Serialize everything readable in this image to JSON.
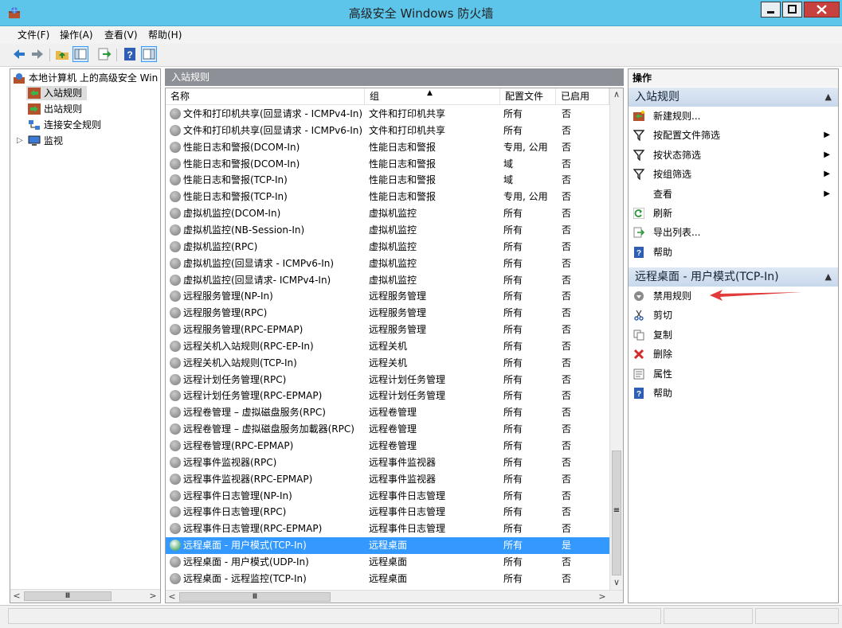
{
  "window": {
    "title": "高级安全 Windows 防火墙",
    "colors": {
      "titlebar": "#5cc5e9",
      "selection": "#3399ff",
      "section_header": "#c8d8ec",
      "annotation_arrow": "#e23b3b"
    }
  },
  "menu": [
    "文件(F)",
    "操作(A)",
    "查看(V)",
    "帮助(H)"
  ],
  "toolbar_icons": [
    "back-arrow-icon",
    "forward-arrow-icon",
    "folder-up-icon",
    "show-hide-tree-icon",
    "export-list-icon",
    "help-icon",
    "show-hide-action-pane-icon"
  ],
  "tree": {
    "root": "本地计算机 上的高级安全 Win",
    "items": [
      {
        "label": "入站规则",
        "selected": true,
        "icon": "inbound-rules-icon"
      },
      {
        "label": "出站规则",
        "icon": "outbound-rules-icon"
      },
      {
        "label": "连接安全规则",
        "icon": "connection-security-icon"
      },
      {
        "label": "监视",
        "icon": "monitor-icon",
        "expander": "▷"
      }
    ],
    "scroll_glyph": "Ⅲ"
  },
  "center": {
    "header": "入站规则",
    "columns": [
      "名称",
      "组",
      "配置文件",
      "已启用"
    ],
    "sort_glyph": "▲",
    "rows": [
      {
        "name": "文件和打印机共享(回显请求 - ICMPv4-In)",
        "group": "文件和打印机共享",
        "profile": "所有",
        "enabled": "否"
      },
      {
        "name": "文件和打印机共享(回显请求 - ICMPv6-In)",
        "group": "文件和打印机共享",
        "profile": "所有",
        "enabled": "否"
      },
      {
        "name": "性能日志和警报(DCOM-In)",
        "group": "性能日志和警报",
        "profile": "专用, 公用",
        "enabled": "否"
      },
      {
        "name": "性能日志和警报(DCOM-In)",
        "group": "性能日志和警报",
        "profile": "域",
        "enabled": "否"
      },
      {
        "name": "性能日志和警报(TCP-In)",
        "group": "性能日志和警报",
        "profile": "域",
        "enabled": "否"
      },
      {
        "name": "性能日志和警报(TCP-In)",
        "group": "性能日志和警报",
        "profile": "专用, 公用",
        "enabled": "否"
      },
      {
        "name": "虚拟机监控(DCOM-In)",
        "group": "虚拟机监控",
        "profile": "所有",
        "enabled": "否"
      },
      {
        "name": "虚拟机监控(NB-Session-In)",
        "group": "虚拟机监控",
        "profile": "所有",
        "enabled": "否"
      },
      {
        "name": "虚拟机监控(RPC)",
        "group": "虚拟机监控",
        "profile": "所有",
        "enabled": "否"
      },
      {
        "name": "虚拟机监控(回显请求 - ICMPv6-In)",
        "group": "虚拟机监控",
        "profile": "所有",
        "enabled": "否"
      },
      {
        "name": "虚拟机监控(回显请求- ICMPv4-In)",
        "group": "虚拟机监控",
        "profile": "所有",
        "enabled": "否"
      },
      {
        "name": "远程服务管理(NP-In)",
        "group": "远程服务管理",
        "profile": "所有",
        "enabled": "否"
      },
      {
        "name": "远程服务管理(RPC)",
        "group": "远程服务管理",
        "profile": "所有",
        "enabled": "否"
      },
      {
        "name": "远程服务管理(RPC-EPMAP)",
        "group": "远程服务管理",
        "profile": "所有",
        "enabled": "否"
      },
      {
        "name": "远程关机入站规则(RPC-EP-In)",
        "group": "远程关机",
        "profile": "所有",
        "enabled": "否"
      },
      {
        "name": "远程关机入站规则(TCP-In)",
        "group": "远程关机",
        "profile": "所有",
        "enabled": "否"
      },
      {
        "name": "远程计划任务管理(RPC)",
        "group": "远程计划任务管理",
        "profile": "所有",
        "enabled": "否"
      },
      {
        "name": "远程计划任务管理(RPC-EPMAP)",
        "group": "远程计划任务管理",
        "profile": "所有",
        "enabled": "否"
      },
      {
        "name": "远程卷管理 – 虚拟磁盘服务(RPC)",
        "group": "远程卷管理",
        "profile": "所有",
        "enabled": "否"
      },
      {
        "name": "远程卷管理 – 虚拟磁盘服务加載器(RPC)",
        "group": "远程卷管理",
        "profile": "所有",
        "enabled": "否"
      },
      {
        "name": "远程卷管理(RPC-EPMAP)",
        "group": "远程卷管理",
        "profile": "所有",
        "enabled": "否"
      },
      {
        "name": "远程事件监视器(RPC)",
        "group": "远程事件监视器",
        "profile": "所有",
        "enabled": "否"
      },
      {
        "name": "远程事件监视器(RPC-EPMAP)",
        "group": "远程事件监视器",
        "profile": "所有",
        "enabled": "否"
      },
      {
        "name": "远程事件日志管理(NP-In)",
        "group": "远程事件日志管理",
        "profile": "所有",
        "enabled": "否"
      },
      {
        "name": "远程事件日志管理(RPC)",
        "group": "远程事件日志管理",
        "profile": "所有",
        "enabled": "否"
      },
      {
        "name": "远程事件日志管理(RPC-EPMAP)",
        "group": "远程事件日志管理",
        "profile": "所有",
        "enabled": "否"
      },
      {
        "name": "远程桌面 - 用户模式(TCP-In)",
        "group": "远程桌面",
        "profile": "所有",
        "enabled": "是",
        "selected": true
      },
      {
        "name": "远程桌面 - 用户模式(UDP-In)",
        "group": "远程桌面",
        "profile": "所有",
        "enabled": "否"
      },
      {
        "name": "远程桌面 - 远程监控(TCP-In)",
        "group": "远程桌面",
        "profile": "所有",
        "enabled": "否"
      }
    ],
    "scroll_glyph": "Ⅲ",
    "vscroll_grip": "≡"
  },
  "actions": {
    "title": "操作",
    "section1": {
      "header": "入站规则",
      "items": [
        {
          "label": "新建规则...",
          "icon": "new-rule-icon"
        },
        {
          "label": "按配置文件筛选",
          "icon": "filter-icon",
          "submenu": true
        },
        {
          "label": "按状态筛选",
          "icon": "filter-icon",
          "submenu": true
        },
        {
          "label": "按组筛选",
          "icon": "filter-icon",
          "submenu": true
        },
        {
          "label": "查看",
          "icon": "",
          "submenu": true
        },
        {
          "label": "刷新",
          "icon": "refresh-icon"
        },
        {
          "label": "导出列表...",
          "icon": "export-list-icon"
        },
        {
          "label": "帮助",
          "icon": "help-icon"
        }
      ]
    },
    "section2": {
      "header": "远程桌面 - 用户模式(TCP-In)",
      "items": [
        {
          "label": "禁用规则",
          "icon": "disable-rule-icon"
        },
        {
          "label": "剪切",
          "icon": "cut-icon"
        },
        {
          "label": "复制",
          "icon": "copy-icon"
        },
        {
          "label": "删除",
          "icon": "delete-icon"
        },
        {
          "label": "属性",
          "icon": "properties-icon"
        },
        {
          "label": "帮助",
          "icon": "help-icon"
        }
      ]
    }
  }
}
